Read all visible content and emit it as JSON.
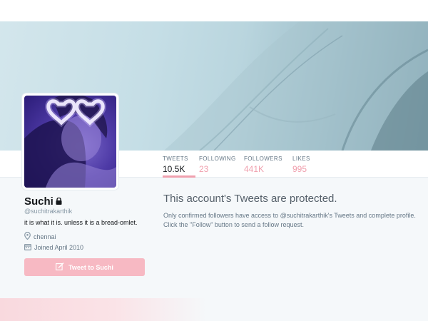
{
  "profile": {
    "name": "Suchi",
    "handle": "@suchitrakarthik",
    "bio": "it is what it is. unless it is a bread-omlet.",
    "location": "chennai",
    "joined": "Joined April 2010",
    "tweet_to_label": "Tweet to Suchi"
  },
  "stats": [
    {
      "label": "TWEETS",
      "value": "10.5K"
    },
    {
      "label": "FOLLOWING",
      "value": "23"
    },
    {
      "label": "FOLLOWERS",
      "value": "441K"
    },
    {
      "label": "LIKES",
      "value": "995"
    }
  ],
  "protected": {
    "title": "This account's Tweets are protected.",
    "text": "Only confirmed followers have access to @suchitrakarthik's Tweets and complete profile. Click the \"Follow\" button to send a follow request."
  },
  "colors": {
    "accent": "#f0a0ae",
    "button": "#f7b9c3",
    "background": "#f5f8fa"
  },
  "icons": [
    "lock-icon",
    "location-pin-icon",
    "calendar-icon",
    "compose-icon"
  ]
}
